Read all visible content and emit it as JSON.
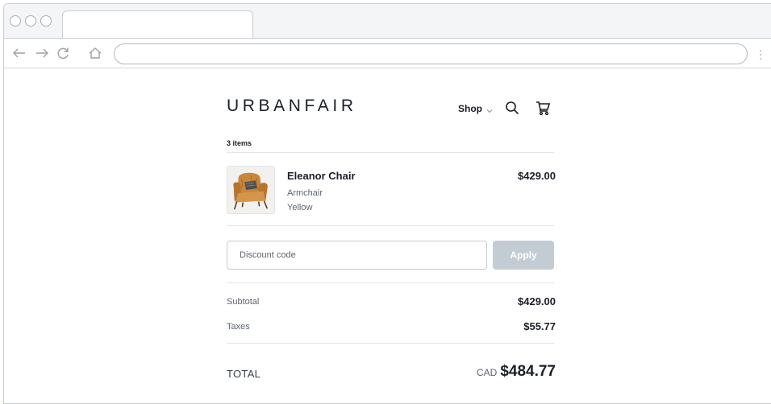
{
  "browser": {
    "icons": [
      "window-close-dot",
      "window-minimize-dot",
      "window-maximize-dot",
      "back-arrow-icon",
      "forward-arrow-icon",
      "reload-icon",
      "home-icon",
      "more-menu-icon"
    ]
  },
  "header": {
    "brand": "URBANFAIR",
    "shop_label": "Shop",
    "icons": [
      "chevron-down-icon",
      "search-icon",
      "cart-icon"
    ]
  },
  "cart": {
    "count_label": "3 items",
    "item": {
      "name": "Eleanor Chair",
      "type": "Armchair",
      "color": "Yellow",
      "price": "$429.00",
      "image_icon": "armchair-photo"
    }
  },
  "discount": {
    "placeholder": "Discount code",
    "apply_label": "Apply"
  },
  "summary": {
    "subtotal_label": "Subtotal",
    "subtotal_value": "$429.00",
    "taxes_label": "Taxes",
    "taxes_value": "$55.77",
    "total_label": "TOTAL",
    "currency": "CAD",
    "total_value": "$484.77"
  },
  "colors": {
    "apply_button_bg": "#c3cbd3",
    "text_primary": "#1a1f28",
    "text_secondary": "#5c6470",
    "divider": "#e2e5e8"
  }
}
